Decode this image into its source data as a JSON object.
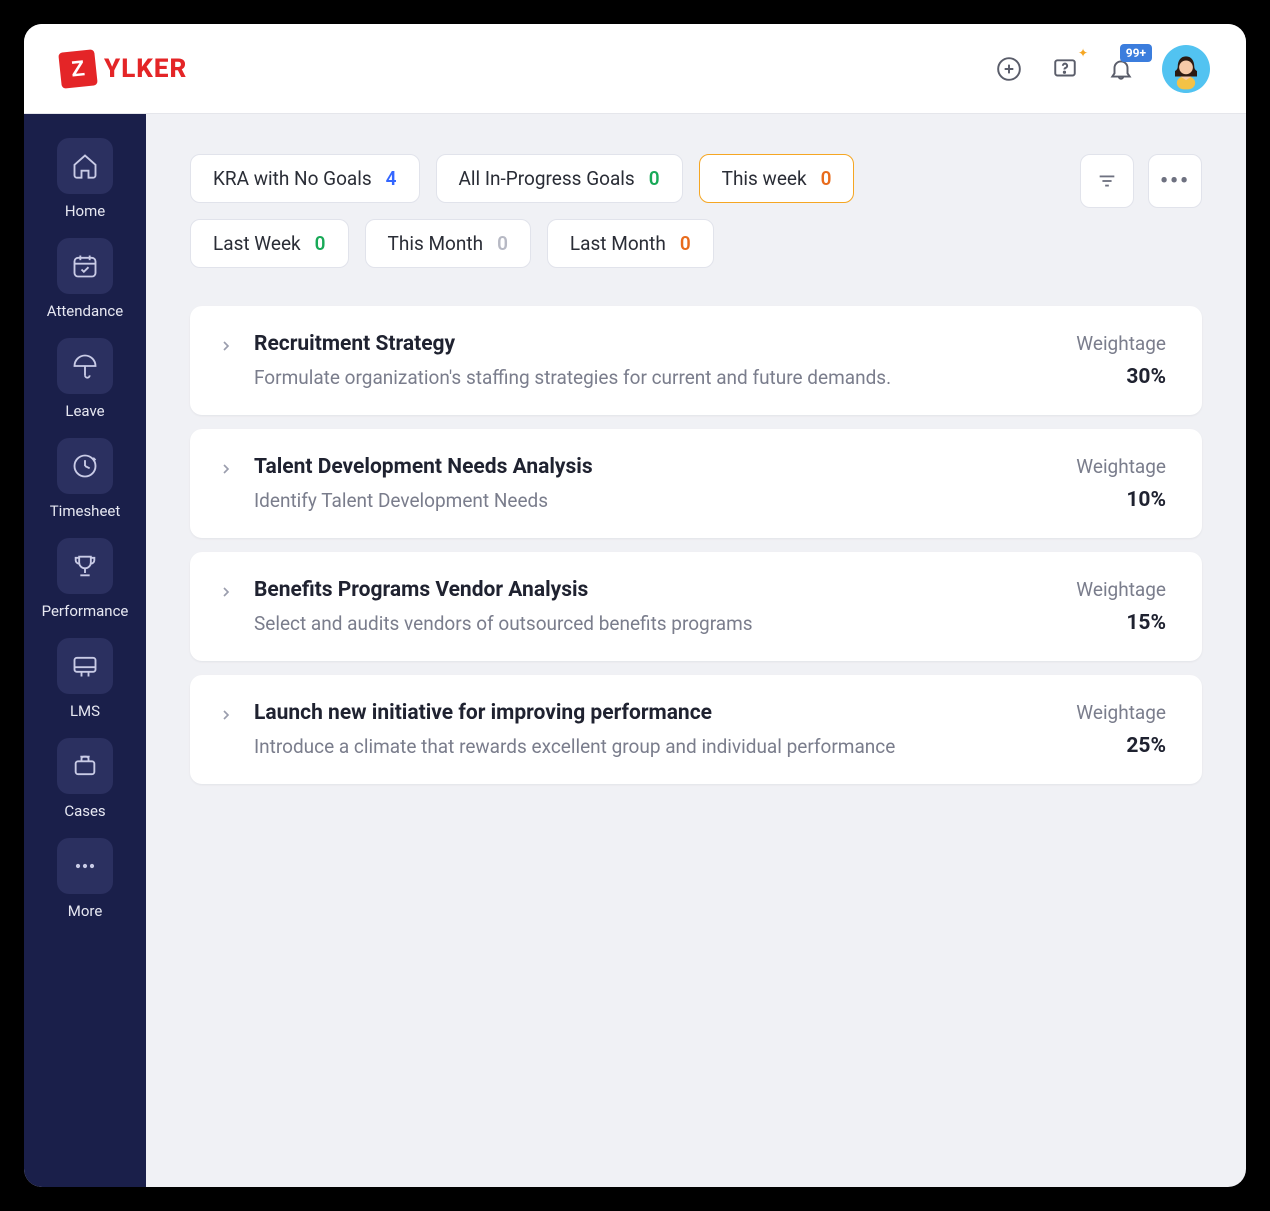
{
  "brand": {
    "mark": "Z",
    "name": "YLKER"
  },
  "topbar": {
    "notifications_badge": "99+"
  },
  "sidebar": {
    "items": [
      {
        "label": "Home"
      },
      {
        "label": "Attendance"
      },
      {
        "label": "Leave"
      },
      {
        "label": "Timesheet"
      },
      {
        "label": "Performance"
      },
      {
        "label": "LMS"
      },
      {
        "label": "Cases"
      },
      {
        "label": "More"
      }
    ]
  },
  "filters": [
    {
      "label": "KRA with No Goals",
      "count": "4",
      "countClass": "count-blue",
      "active": false
    },
    {
      "label": "All In-Progress Goals",
      "count": "0",
      "countClass": "count-green",
      "active": false
    },
    {
      "label": "This week",
      "count": "0",
      "countClass": "count-orange",
      "active": true
    },
    {
      "label": "Last Week",
      "count": "0",
      "countClass": "count-green",
      "active": false
    },
    {
      "label": "This Month",
      "count": "0",
      "countClass": "count-gray",
      "active": false
    },
    {
      "label": "Last Month",
      "count": "0",
      "countClass": "count-orange",
      "active": false
    }
  ],
  "weightage_label": "Weightage",
  "kras": [
    {
      "title": "Recruitment Strategy",
      "desc": "Formulate organization's staffing strategies for current and future demands.",
      "weight": "30%"
    },
    {
      "title": "Talent Development Needs Analysis",
      "desc": "Identify Talent Development Needs",
      "weight": "10%"
    },
    {
      "title": "Benefits Programs Vendor Analysis",
      "desc": "Select and audits vendors of outsourced benefits programs",
      "weight": "15%"
    },
    {
      "title": "Launch new initiative for improving performance",
      "desc": "Introduce a climate that rewards excellent group and individual performance",
      "weight": "25%"
    }
  ]
}
